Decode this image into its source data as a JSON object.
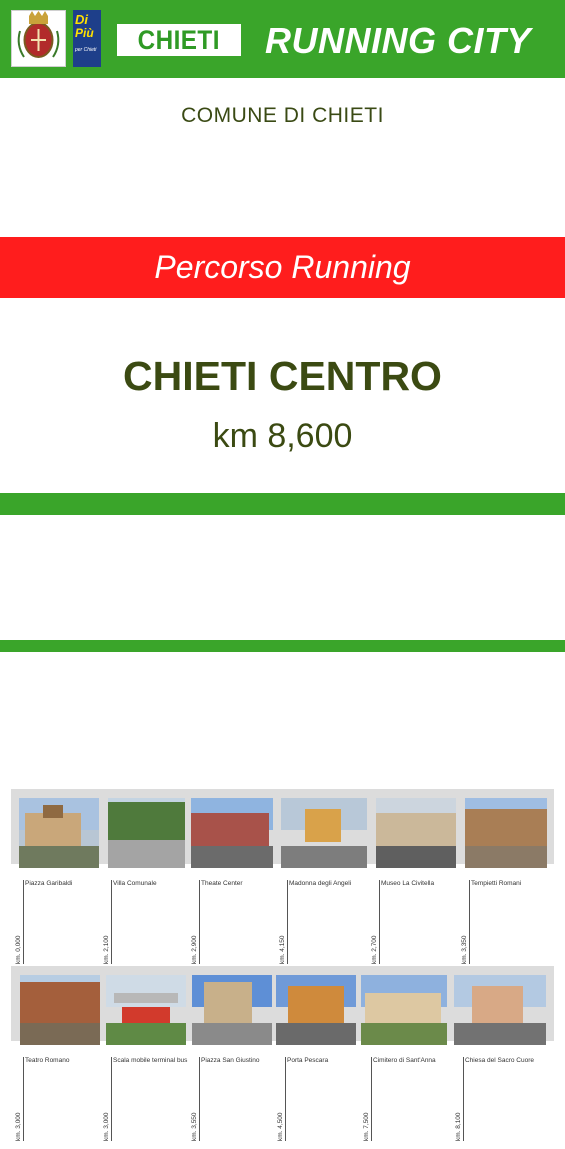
{
  "header": {
    "city_label": "CHIETI",
    "banner_title": "RUNNING CITY",
    "crest_icon": "city-coat-of-arms",
    "partner_logo": {
      "line1": "Di",
      "line2": "Più",
      "line3": "per Chieti"
    }
  },
  "comune": "COMUNE DI CHIETI",
  "route_type": "Percorso Running",
  "route_name": "CHIETI CENTRO",
  "route_length": "km 8,600",
  "colors": {
    "green": "#3aa52a",
    "red": "#ff1d1d",
    "text_dark": "#3b4a12"
  },
  "stops_row1": [
    {
      "name": "Piazza Garibaldi",
      "km": "km. 0,000"
    },
    {
      "name": "Villa Comunale",
      "km": "km. 2,100"
    },
    {
      "name": "Theate Center",
      "km": "km. 2,900"
    },
    {
      "name": "Madonna degli Angeli",
      "km": "km. 4,150"
    },
    {
      "name": "Museo La Civitella",
      "km": "km. 2,700"
    },
    {
      "name": "Tempietti Romani",
      "km": "km. 3,350"
    }
  ],
  "stops_row2": [
    {
      "name": "Teatro Romano",
      "km": "km. 3,000"
    },
    {
      "name": "Scala mobile terminal bus",
      "km": "km. 3,000"
    },
    {
      "name": "Piazza San Giustino",
      "km": "km. 3,550"
    },
    {
      "name": "Porta Pescara",
      "km": "km. 4,500"
    },
    {
      "name": "Cimitero di Sant'Anna",
      "km": "km. 7,500"
    },
    {
      "name": "Chiesa del Sacro Cuore",
      "km": "km. 8,100"
    }
  ]
}
